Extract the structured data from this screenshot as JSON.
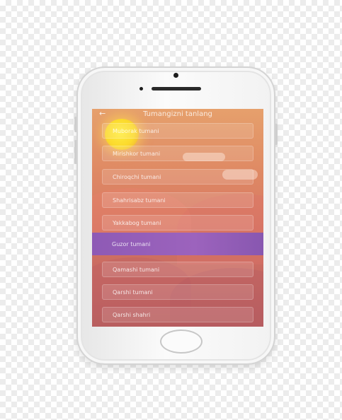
{
  "header": {
    "back_icon": "arrow-left-icon",
    "title": "Tumangizni tanlang"
  },
  "districts": [
    {
      "label": "Muborak tumani"
    },
    {
      "label": "Mirishkor tumani"
    },
    {
      "label": "Chiroqchi tumani"
    },
    {
      "label": "Shahrisabz tumani"
    },
    {
      "label": "Yakkabog tumani"
    },
    {
      "label": "Guzor tumani",
      "selected": true
    },
    {
      "label": "Qamashi tumani"
    },
    {
      "label": "Qarshi tumani"
    },
    {
      "label": "Qarshi shahri"
    }
  ],
  "colors": {
    "sky_top": "#e6a06c",
    "sky_bottom": "#b85e5f",
    "selected_row": "#9c63bd",
    "sun": "#fbd92c"
  }
}
